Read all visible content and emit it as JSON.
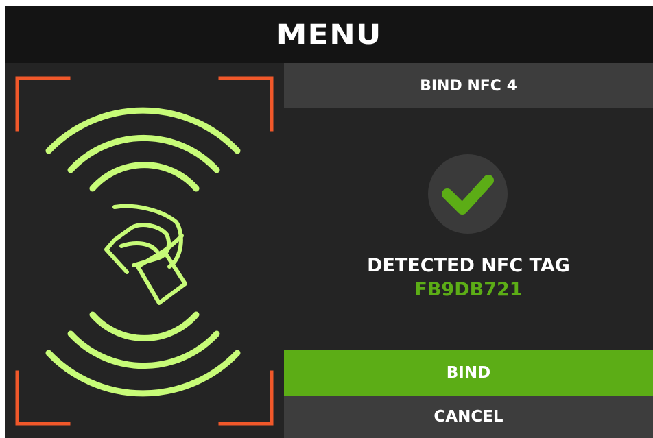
{
  "header": {
    "title": "MENU"
  },
  "panel": {
    "title": "BIND NFC 4",
    "status_text": "DETECTED NFC TAG",
    "tag_id": "FB9DB721",
    "bind_label": "BIND",
    "cancel_label": "CANCEL"
  },
  "icons": {
    "illustration": "nfc-tap-icon",
    "status": "checkmark-icon"
  },
  "colors": {
    "accent_green": "#5cad16",
    "illustration_green": "#c7fb78",
    "corner_orange": "#f0582a",
    "background": "#242424",
    "header_bg": "#141414",
    "bar_bg": "#3d3d3d"
  }
}
